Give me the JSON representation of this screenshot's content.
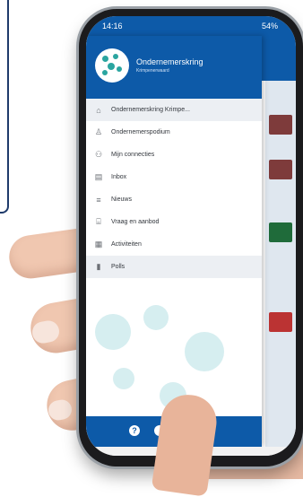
{
  "status_bar": {
    "time": "14:16",
    "battery": "54%"
  },
  "drawer": {
    "org_name": "Ondernemerskring",
    "org_subtitle": "Krimpenerwaard",
    "menu": [
      {
        "label": "Ondernemerskring Krimpe...",
        "icon": "home-icon",
        "active": true
      },
      {
        "label": "Ondernemerspodium",
        "icon": "person-icon",
        "active": false
      },
      {
        "label": "Mijn connecties",
        "icon": "connections-icon",
        "active": false
      },
      {
        "label": "Inbox",
        "icon": "inbox-icon",
        "active": false
      },
      {
        "label": "Nieuws",
        "icon": "news-icon",
        "active": false
      },
      {
        "label": "Vraag en aanbod",
        "icon": "marketplace-icon",
        "active": false
      },
      {
        "label": "Activiteiten",
        "icon": "calendar-icon",
        "active": false
      },
      {
        "label": "Polls",
        "icon": "poll-icon",
        "active": true
      }
    ]
  },
  "colors": {
    "brand": "#0d5aa8",
    "accent": "#2aa5a0"
  }
}
